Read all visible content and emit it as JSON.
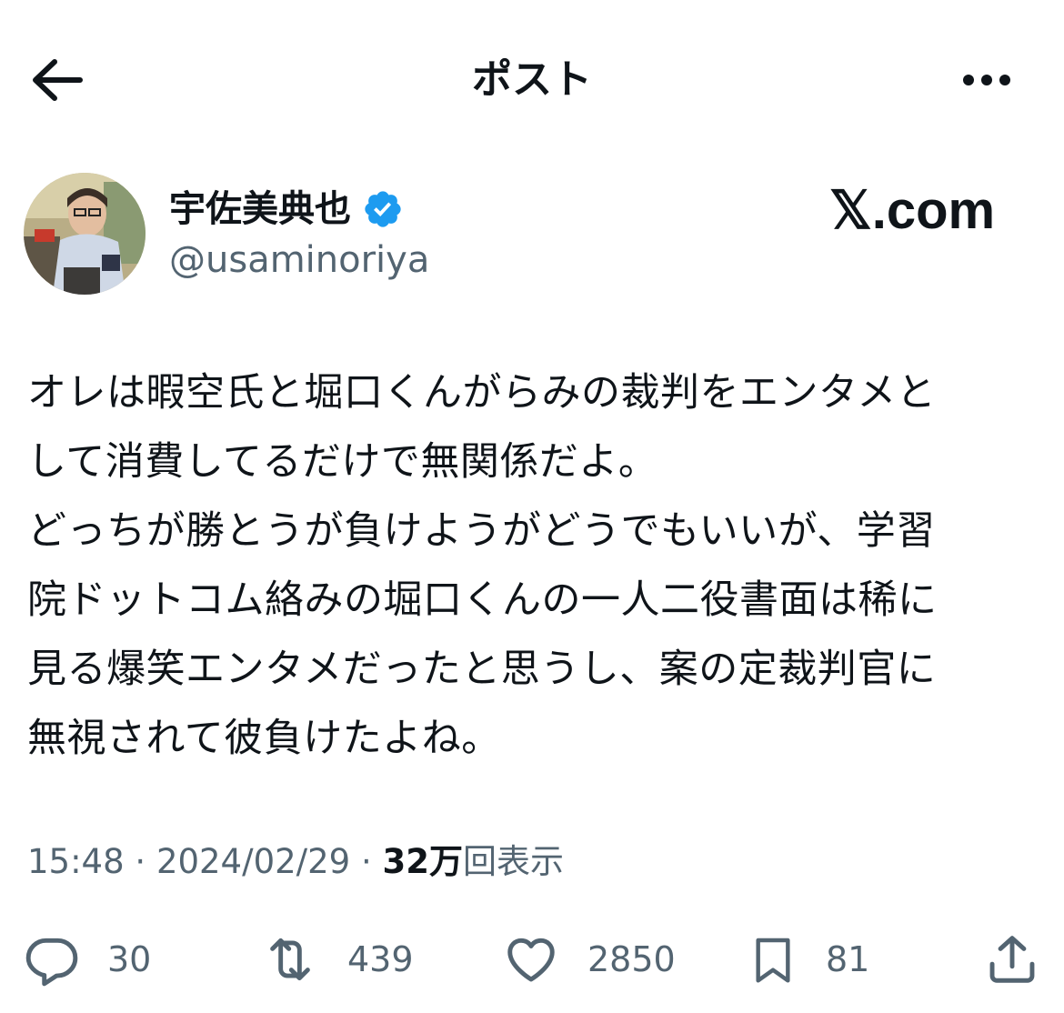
{
  "header": {
    "title": "ポスト"
  },
  "author": {
    "display_name": "宇佐美典也",
    "handle": "@usaminoriya",
    "verified": true
  },
  "watermark": "𝕏.com",
  "tweet": {
    "lines": [
      "オレは暇空氏と堀口くんがらみの裁判をエンタメと",
      "して消費してるだけで無関係だよ。",
      "どっちが勝とうが負けようがどうでもいいが、学習",
      "院ドットコム絡みの堀口くんの一人二役書面は稀に",
      "見る爆笑エンタメだったと思うし、案の定裁判官に",
      "無視されて彼負けたよね。"
    ]
  },
  "meta": {
    "time": "15:48",
    "separator": "·",
    "date": "2024/02/29",
    "views_count": "32万",
    "views_label": "回表示"
  },
  "actions": {
    "replies": "30",
    "reposts": "439",
    "likes": "2850",
    "bookmarks": "81"
  },
  "icons": [
    "back-arrow-icon",
    "more-dots-icon",
    "verified-badge-icon",
    "reply-icon",
    "repost-icon",
    "like-icon",
    "bookmark-icon",
    "share-icon"
  ],
  "colors": {
    "verified": "#1d9bf0",
    "secondary_text": "#536471",
    "primary_text": "#0f1419"
  }
}
